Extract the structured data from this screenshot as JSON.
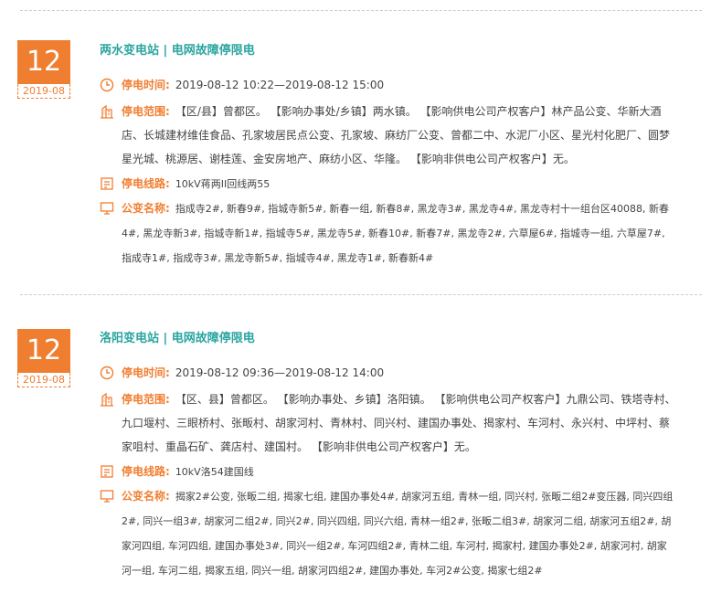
{
  "labels": {
    "time": "停电时间:",
    "scope": "停电范围:",
    "line": "停电线路:",
    "station": "公变名称:"
  },
  "notices": [
    {
      "day": "12",
      "month": "2019-08",
      "title": "两水变电站 | 电网故障停限电",
      "time": "2019-08-12 10:22—2019-08-12 15:00",
      "scope": "【区/县】曾都区。 【影响办事处/乡镇】两水镇。 【影响供电公司产权客户】林产品公变、华新大酒店、长城建材维佳食品、孔家坡居民点公变、孔家坡、麻纺厂公变、曾都二中、水泥厂小区、星光村化肥厂、圆梦星光城、桃源居、谢桂莲、金安房地产、麻纺小区、华隆。 【影响非供电公司产权客户】无。",
      "line": "10kV蒋两II回线两55",
      "stations": "指成寺2#, 新春9#, 指城寺新5#, 新春一组, 新春8#, 黑龙寺3#, 黑龙寺4#, 黑龙寺村十一组台区40088, 新春4#, 黑龙寺新3#, 指城寺新1#, 指城寺5#, 黑龙寺5#, 新春10#, 新春7#, 黑龙寺2#, 六草屋6#, 指城寺一组, 六草屋7#, 指成寺1#, 指成寺3#, 黑龙寺新5#, 指城寺4#, 黑龙寺1#, 新春新4#"
    },
    {
      "day": "12",
      "month": "2019-08",
      "title": "洛阳变电站 | 电网故障停限电",
      "time": "2019-08-12 09:36—2019-08-12 14:00",
      "scope": "【区、县】曾都区。 【影响办事处、乡镇】洛阳镇。 【影响供电公司产权客户】九鼎公司、铁塔寺村、九口堰村、三眼桥村、张畈村、胡家河村、青林村、同兴村、建国办事处、揭家村、车河村、永兴村、中坪村、蔡家咀村、重晶石矿、龚店村、建国村。 【影响非供电公司产权客户】无。",
      "line": "10kV洛54建国线",
      "stations": "揭家2#公变, 张畈二组, 揭家七组, 建国办事处4#, 胡家河五组, 青林一组, 同兴村, 张畈二组2#变压器, 同兴四组2#, 同兴一组3#, 胡家河二组2#, 同兴2#, 同兴四组, 同兴六组, 青林一组2#, 张畈二组3#, 胡家河二组, 胡家河五组2#, 胡家河四组, 车河四组, 建国办事处3#, 同兴一组2#, 车河四组2#, 青林二组, 车河村, 揭家村, 建国办事处2#, 胡家河村, 胡家河一组, 车河二组, 揭家五组, 同兴一组, 胡家河四组2#, 建国办事处, 车河2#公变, 揭家七组2#"
    }
  ]
}
